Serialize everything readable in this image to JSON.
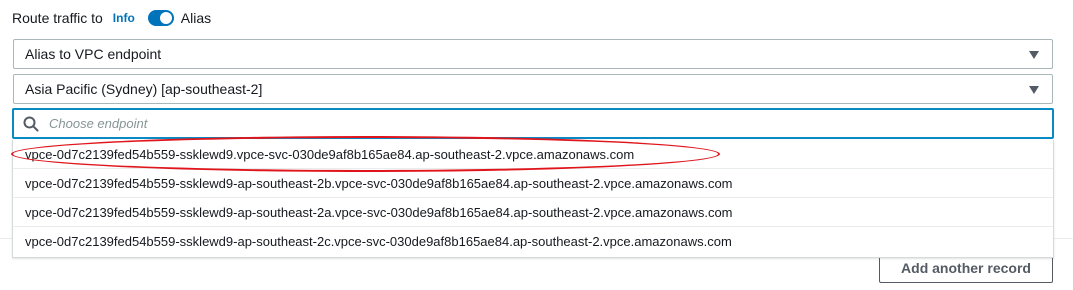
{
  "route": {
    "label": "Route traffic to",
    "info": "Info",
    "alias_label": "Alias",
    "alias_enabled": true
  },
  "endpoint_type": {
    "value": "Alias to VPC endpoint"
  },
  "region": {
    "value": "Asia Pacific (Sydney) [ap-southeast-2]"
  },
  "search": {
    "placeholder": "Choose endpoint",
    "value": ""
  },
  "options": [
    "vpce-0d7c2139fed54b559-ssklewd9.vpce-svc-030de9af8b165ae84.ap-southeast-2.vpce.amazonaws.com",
    "vpce-0d7c2139fed54b559-ssklewd9-ap-southeast-2b.vpce-svc-030de9af8b165ae84.ap-southeast-2.vpce.amazonaws.com",
    "vpce-0d7c2139fed54b559-ssklewd9-ap-southeast-2a.vpce-svc-030de9af8b165ae84.ap-southeast-2.vpce.amazonaws.com",
    "vpce-0d7c2139fed54b559-ssklewd9-ap-southeast-2c.vpce-svc-030de9af8b165ae84.ap-southeast-2.vpce.amazonaws.com"
  ],
  "actions": {
    "add_record": "Add another record"
  },
  "colors": {
    "accent": "#0073bb",
    "focus_border": "#0a8ac4",
    "annotation": "#e0151b"
  }
}
